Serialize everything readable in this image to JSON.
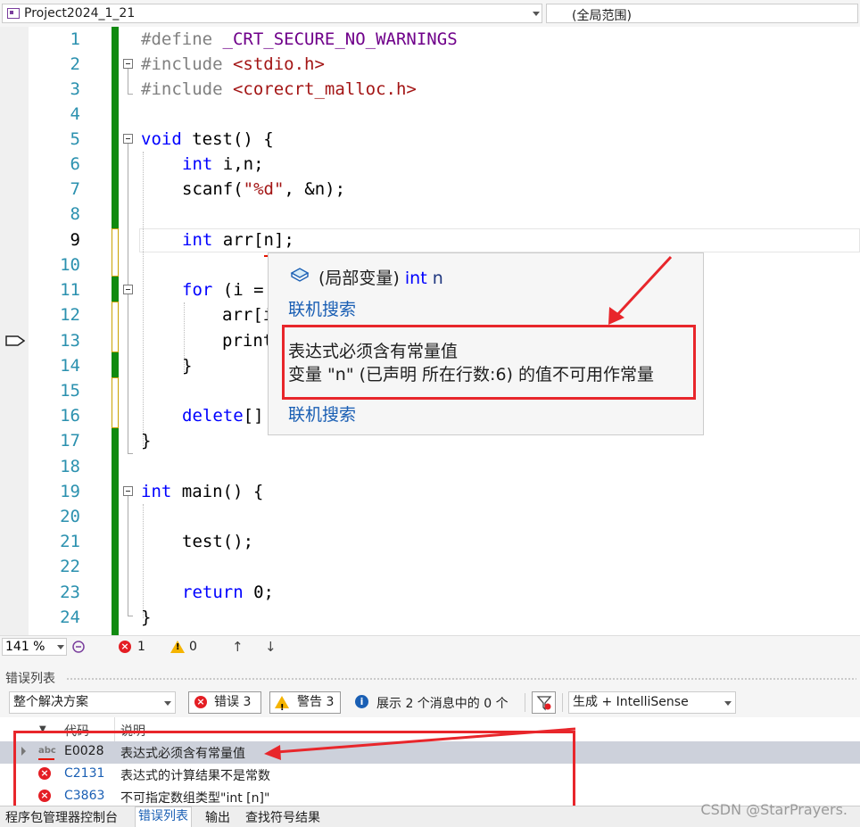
{
  "nav": {
    "project": "Project2024_1_21",
    "scope": "(全局范围)"
  },
  "editor": {
    "line_numbers": [
      "1",
      "2",
      "3",
      "4",
      "5",
      "6",
      "7",
      "8",
      "9",
      "10",
      "11",
      "12",
      "13",
      "14",
      "15",
      "16",
      "17",
      "18",
      "19",
      "20",
      "21",
      "22",
      "23",
      "24"
    ],
    "code": {
      "l1_define": "#define",
      "l1_macro": "_CRT_SECURE_NO_WARNINGS",
      "l2_include": "#include",
      "l2_header": "<stdio.h>",
      "l3_include": "#include",
      "l3_header": "<corecrt_malloc.h>",
      "l5_void": "void",
      "l5_rest": " test() {",
      "l6_int": "int",
      "l6_rest": " i,n;",
      "l7_pre": "scanf(",
      "l7_str": "\"%d\"",
      "l7_post": ", &n);",
      "l9_int": "int",
      "l9_rest": " arr[n];",
      "l11_for": "for",
      "l11_rest": " (i =",
      "l12": "arr[i",
      "l13": "print",
      "l14": "}",
      "l16_delete": "delete",
      "l16_rest": "[]",
      "l17": "}",
      "l19_int": "int",
      "l19_rest": " main() {",
      "l21": "test();",
      "l23_return": "return",
      "l23_rest": " 0;",
      "l24": "}"
    }
  },
  "tooltip": {
    "sig_prefix": "(局部变量) ",
    "sig_type": "int",
    "sig_name": " n",
    "link1": "联机搜索",
    "msg1": "表达式必须含有常量值",
    "msg2": "变量 \"n\" (已声明 所在行数:6) 的值不可用作常量",
    "link2": "联机搜索"
  },
  "status": {
    "zoom": "141 %",
    "errors": "1",
    "warnings": "0"
  },
  "error_list": {
    "title": "错误列表",
    "scope": "整个解决方案",
    "errors_btn": "错误 3",
    "warnings_btn": "警告 3",
    "messages": "展示 2 个消息中的 0 个",
    "source": "生成 + IntelliSense",
    "headers": {
      "code": "代码",
      "desc": "说明"
    },
    "rows": [
      {
        "code": "E0028",
        "desc": "表达式必须含有常量值"
      },
      {
        "code": "C2131",
        "desc": "表达式的计算结果不是常数"
      },
      {
        "code": "C3863",
        "desc": "不可指定数组类型\"int [n]\""
      }
    ]
  },
  "tabs": [
    "程序包管理器控制台",
    "错误列表",
    "输出",
    "查找符号结果"
  ],
  "watermark": "CSDN @StarPrayers.",
  "colors": {
    "change_green": "#108a10",
    "annotation_red": "#e8262b",
    "keyword_blue": "#0000ff"
  }
}
